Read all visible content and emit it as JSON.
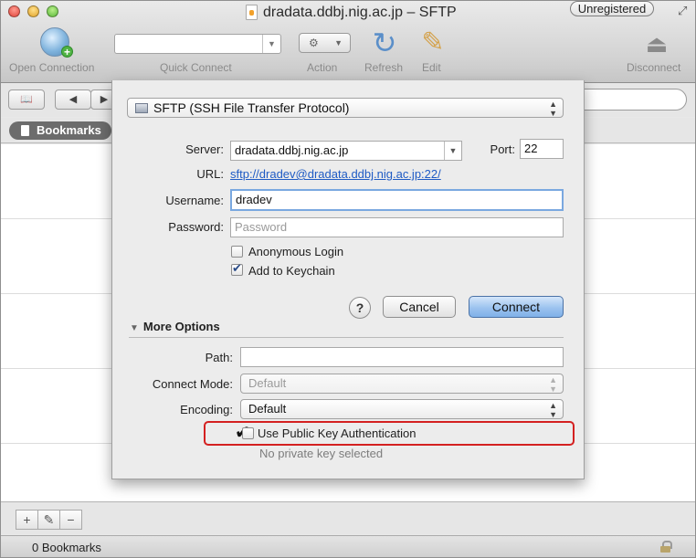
{
  "window": {
    "title": "dradata.ddbj.nig.ac.jp – SFTP",
    "badge": "Unregistered"
  },
  "toolbar": {
    "open_connection": "Open Connection",
    "quick_connect": "Quick Connect",
    "action": "Action",
    "refresh": "Refresh",
    "edit": "Edit",
    "disconnect": "Disconnect"
  },
  "bookmarks": {
    "tab_label": "Bookmarks",
    "count_label": "0 Bookmarks"
  },
  "dialog": {
    "protocol": "SFTP (SSH File Transfer Protocol)",
    "server_label": "Server:",
    "server_value": "dradata.ddbj.nig.ac.jp",
    "port_label": "Port:",
    "port_value": "22",
    "url_label": "URL:",
    "url_value": "sftp://dradev@dradata.ddbj.nig.ac.jp:22/",
    "username_label": "Username:",
    "username_value": "dradev",
    "password_label": "Password:",
    "password_placeholder": "Password",
    "anonymous_login": "Anonymous Login",
    "add_to_keychain": "Add to Keychain",
    "help": "?",
    "cancel": "Cancel",
    "connect": "Connect",
    "more_options": "More Options",
    "path_label": "Path:",
    "path_value": "",
    "connect_mode_label": "Connect Mode:",
    "connect_mode_value": "Default",
    "encoding_label": "Encoding:",
    "encoding_value": "Default",
    "public_key_auth": "Use Public Key Authentication",
    "no_private_key": "No private key selected"
  },
  "colors": {
    "highlight": "#d42020",
    "link": "#1f5bc4",
    "default_button": "#7fb0e8"
  }
}
